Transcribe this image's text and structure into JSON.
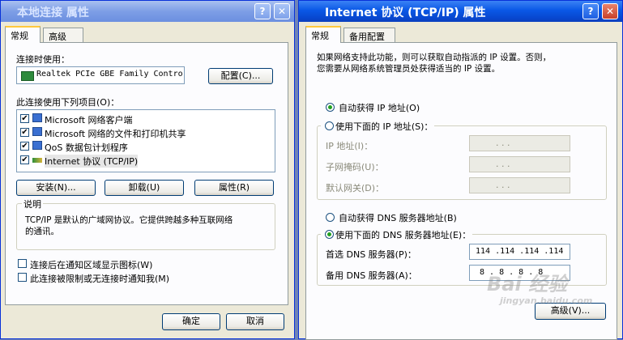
{
  "left_window": {
    "title": "本地连接 属性",
    "help_glyph": "?",
    "close_glyph": "✕",
    "tabs": [
      "常规",
      "高级"
    ],
    "connect_using_label": "连接时使用：",
    "adapter_name": "Realtek PCIe GBE Family Contro",
    "configure_button": "配置(C)...",
    "items_label": "此连接使用下列项目(O)：",
    "items": [
      {
        "label": "Microsoft 网络客户端",
        "checked": true,
        "icon": "network-client-icon"
      },
      {
        "label": "Microsoft 网络的文件和打印机共享",
        "checked": true,
        "icon": "file-printer-share-icon"
      },
      {
        "label": "QoS 数据包计划程序",
        "checked": true,
        "icon": "qos-icon"
      },
      {
        "label": "Internet 协议 (TCP/IP)",
        "checked": true,
        "icon": "protocol-icon"
      }
    ],
    "install_button": "安装(N)...",
    "uninstall_button": "卸载(U)",
    "properties_button": "属性(R)",
    "description_title": "说明",
    "description_line1": "TCP/IP 是默认的广域网协议。它提供跨越多种互联网络",
    "description_line2": "的通讯。",
    "show_icon_label": "连接后在通知区域显示图标(W)",
    "notify_label": "此连接被限制或无连接时通知我(M)",
    "ok_button": "确定",
    "cancel_button": "取消",
    "check_glyph": "✔"
  },
  "right_window": {
    "title": "Internet 协议 (TCP/IP) 属性",
    "help_glyph": "?",
    "close_glyph": "✕",
    "tabs": [
      "常规",
      "备用配置"
    ],
    "intro_line1": "如果网络支持此功能，则可以获取自动指派的 IP 设置。否则，",
    "intro_line2": "您需要从网络系统管理员处获得适当的 IP 设置。",
    "auto_ip_label": "自动获得 IP 地址(O)",
    "manual_ip_label": "使用下面的 IP 地址(S)：",
    "ip_address_label": "IP 地址(I)：",
    "subnet_label": "子网掩码(U)：",
    "gateway_label": "默认网关(D)：",
    "ip_dots": ".   .   .",
    "auto_dns_label": "自动获得 DNS 服务器地址(B)",
    "manual_dns_label": "使用下面的 DNS 服务器地址(E)：",
    "preferred_dns_label": "首选 DNS 服务器(P)：",
    "alternate_dns_label": "备用 DNS 服务器(A)：",
    "preferred_dns_value": "114 .114 .114 .114",
    "alternate_dns_value": "8  .  8  .  8  .  8",
    "advanced_button": "高级(V)...",
    "watermark_text": "Bai 经验",
    "watermark_url": "jingyan.baidu.com"
  },
  "colors": {
    "titlebar_active": "#0a58e6",
    "titlebar_inactive": "#7d9ee6",
    "window_bg": "#ece9d8",
    "radio_dot": "#21a121"
  }
}
